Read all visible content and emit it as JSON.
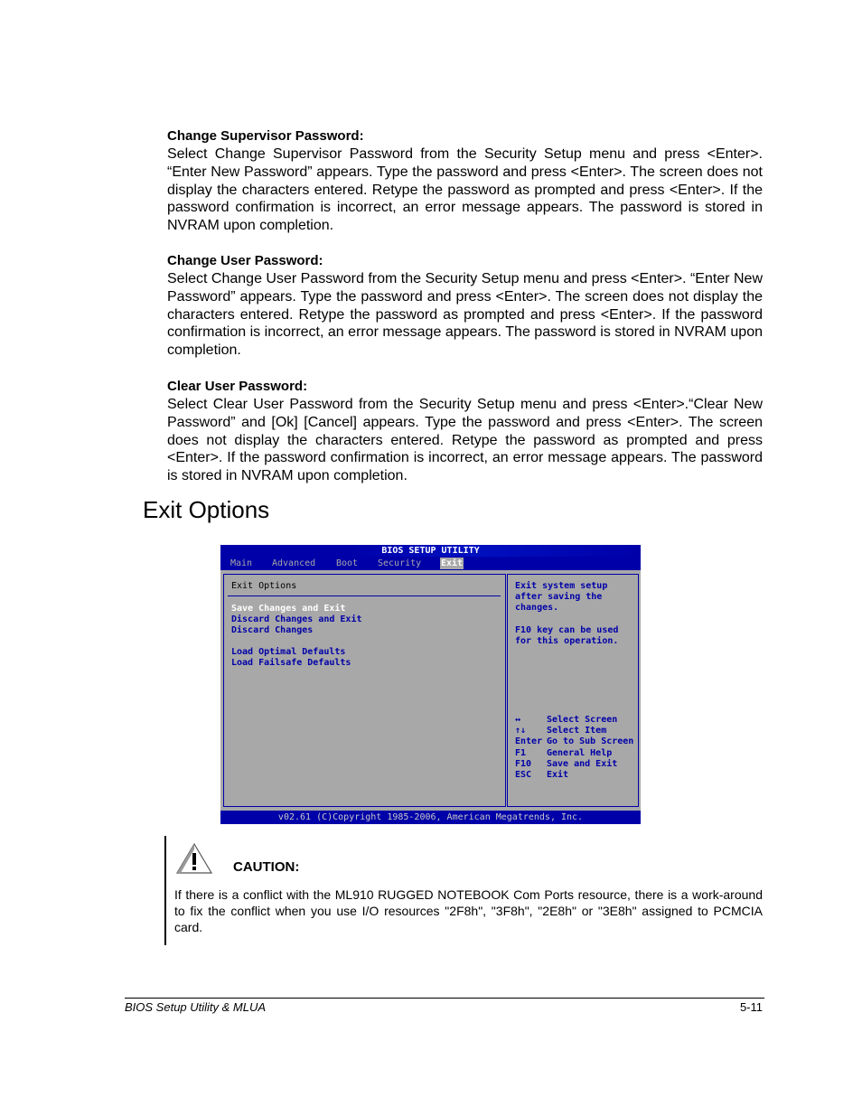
{
  "sections": [
    {
      "heading": "Change Supervisor Password:",
      "body": "Select Change Supervisor Password from the Security Setup menu and press <Enter>. “Enter New Password” appears. Type the password and press <Enter>. The screen does not display the characters entered. Retype the password as prompted and press <Enter>. If the password confirmation is incorrect, an error message appears.  The password is stored in NVRAM upon completion."
    },
    {
      "heading": "Change User Password:",
      "body": "Select Change User Password from the Security Setup menu and press <Enter>. “Enter New Password” appears. Type the password and press <Enter>. The screen does not display the characters entered. Retype the password as prompted and press <Enter>. If the password confirmation is incorrect, an error message appears.  The password is stored in NVRAM upon completion."
    },
    {
      "heading": "Clear User Password:",
      "body": "Select Clear User Password from the Security Setup menu and press <Enter>.“Clear New Password” and [Ok] [Cancel] appears. Type the password and press <Enter>. The screen does not display the characters entered. Retype the password as prompted and press <Enter>. If the password confirmation is incorrect, an error message appears. The password is stored in NVRAM upon completion."
    }
  ],
  "exit_heading": "Exit Options",
  "bios": {
    "title": "BIOS SETUP UTILITY",
    "tabs": [
      {
        "label": "Main",
        "active": false
      },
      {
        "label": "Advanced",
        "active": false
      },
      {
        "label": "Boot",
        "active": false
      },
      {
        "label": "Security",
        "active": false
      },
      {
        "label": "Exit",
        "active": true
      }
    ],
    "panel_title": "Exit Options",
    "items": [
      {
        "label": "Save Changes and Exit",
        "selected": true
      },
      {
        "label": "Discard Changes and Exit",
        "selected": false
      },
      {
        "label": "Discard Changes",
        "selected": false
      },
      {
        "label": "Load Optimal Defaults",
        "selected": false
      },
      {
        "label": "Load Failsafe Defaults",
        "selected": false
      }
    ],
    "help_lines": [
      "Exit system setup",
      "after saving the",
      "changes.",
      "",
      "F10 key can be used",
      "for this operation."
    ],
    "keys": [
      {
        "key": "↔",
        "action": "Select Screen"
      },
      {
        "key": "↑↓",
        "action": "Select Item"
      },
      {
        "key": "Enter",
        "action": "Go to Sub Screen"
      },
      {
        "key": "F1",
        "action": "General Help"
      },
      {
        "key": "F10",
        "action": "Save and Exit"
      },
      {
        "key": "ESC",
        "action": "Exit"
      }
    ],
    "footer": "v02.61 (C)Copyright 1985-2006, American Megatrends, Inc.",
    "colors": {
      "blue": "#0000a8",
      "gray": "#a8a8a8",
      "white": "#ffffff"
    }
  },
  "caution": {
    "icon": "warning-triangle-icon",
    "label": "CAUTION:",
    "text": "If there is a conflict with the ML910 RUGGED NOTEBOOK Com Ports resource, there is a work-around to fix the conflict when you use I/O resources \"2F8h\", \"3F8h\", \"2E8h\" or \"3E8h\" assigned to PCMCIA card."
  },
  "footer": {
    "left": "BIOS Setup Utility & MLUA",
    "right": "5-11"
  }
}
